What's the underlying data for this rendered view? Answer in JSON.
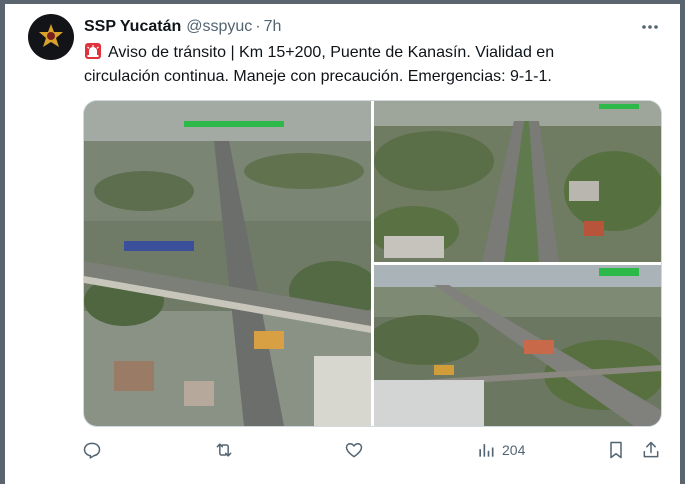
{
  "tweet": {
    "author_name": "SSP Yucatán",
    "handle": "@sspyuc",
    "separator": "·",
    "time": "7h",
    "text": "Aviso de tránsito | Km 15+200, Puente de Kanasín. Vialidad en circulación continua. Maneje con precaución. Emergencias: 9-1-1."
  },
  "media": {
    "images": [
      {
        "description_icon": "aerial-highway-overpass-photo"
      },
      {
        "description_icon": "aerial-highway-road-photo"
      },
      {
        "description_icon": "aerial-highway-bridge-photo"
      }
    ]
  },
  "actions": {
    "reply_icon": "reply-icon",
    "retweet_icon": "retweet-icon",
    "like_icon": "like-icon",
    "views_icon": "views-icon",
    "views_count": "204",
    "bookmark_icon": "bookmark-icon",
    "share_icon": "share-icon"
  },
  "colors": {
    "text_primary": "#0f1419",
    "text_secondary": "#536471",
    "border": "#cfd9de",
    "frame": "#5a6570",
    "siren_red": "#e0323c"
  }
}
